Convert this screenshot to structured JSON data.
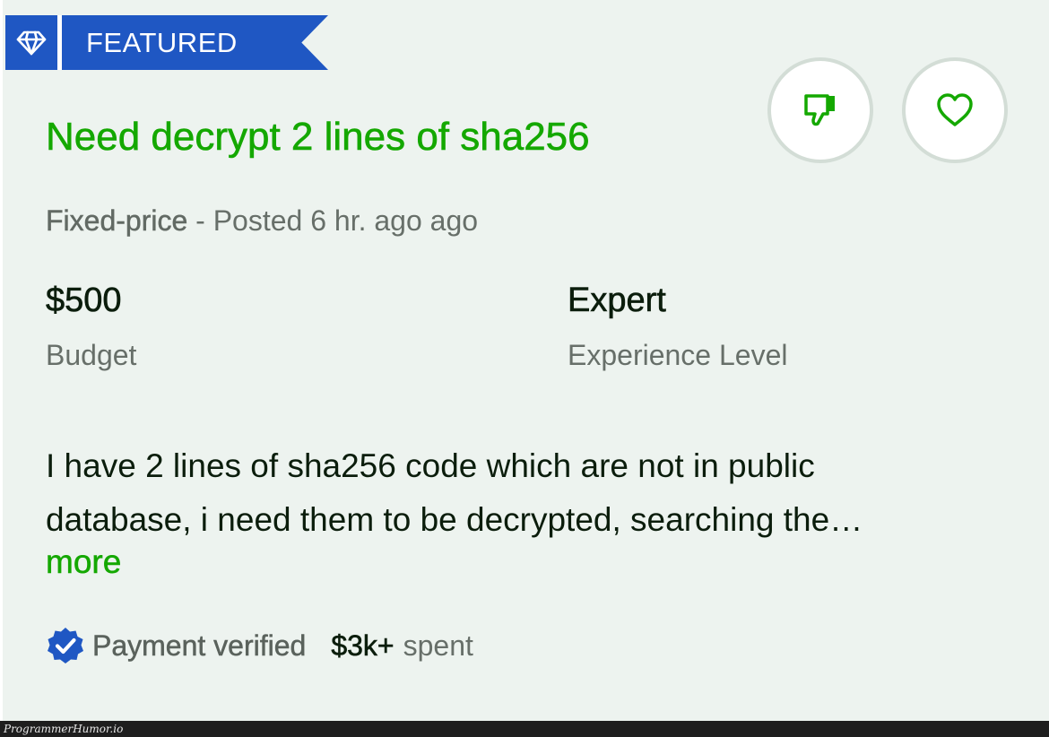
{
  "badge": {
    "label": "FEATURED",
    "icon": "diamond-icon",
    "color": "#1f57c3"
  },
  "job": {
    "title": "Need decrypt 2 lines of sha256",
    "job_type": "Fixed-price",
    "separator": " - ",
    "posted": "Posted 6 hr. ago ago",
    "budget_value": "$500",
    "budget_label": "Budget",
    "experience_value": "Expert",
    "experience_label": "Experience Level",
    "description_lines": [
      "I have 2 lines of sha256 code which are not in public",
      "database, i need them to be decrypted, searching the…"
    ],
    "more_label": "more"
  },
  "actions": {
    "dislike_icon": "thumbs-down-icon",
    "save_icon": "heart-icon"
  },
  "client": {
    "verified_icon": "verified-badge-icon",
    "payment_status": "Payment verified",
    "spent_amount": "$3k+",
    "spent_label": "spent"
  },
  "footer": {
    "watermark": "ProgrammerHumor.io"
  },
  "colors": {
    "accent_green": "#14a800",
    "badge_blue": "#1f57c3",
    "card_background": "#edf3ef"
  }
}
